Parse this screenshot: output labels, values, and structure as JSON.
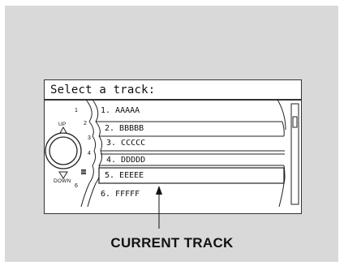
{
  "screen": {
    "title": "Select a track:",
    "tracks": [
      {
        "label": "1. AAAAA",
        "knob_position": "1"
      },
      {
        "label": "2. BBBBB",
        "knob_position": "2"
      },
      {
        "label": "3. CCCCC",
        "knob_position": "3"
      },
      {
        "label": "4. DDDDD",
        "knob_position": "4"
      },
      {
        "label": "5. EEEEE",
        "knob_position": "5",
        "current": true
      },
      {
        "label": "6. FFFFF",
        "knob_position": "6"
      }
    ],
    "up_label": "UP",
    "down_label": "DOWN"
  },
  "caption": "CURRENT TRACK",
  "colors": {
    "background": "#d9d9d9",
    "screen": "#ffffff",
    "ink": "#111111"
  },
  "icons": [
    "knob-icon",
    "up-arrow-icon",
    "down-arrow-icon",
    "select-icon",
    "scrollbar-icon"
  ]
}
